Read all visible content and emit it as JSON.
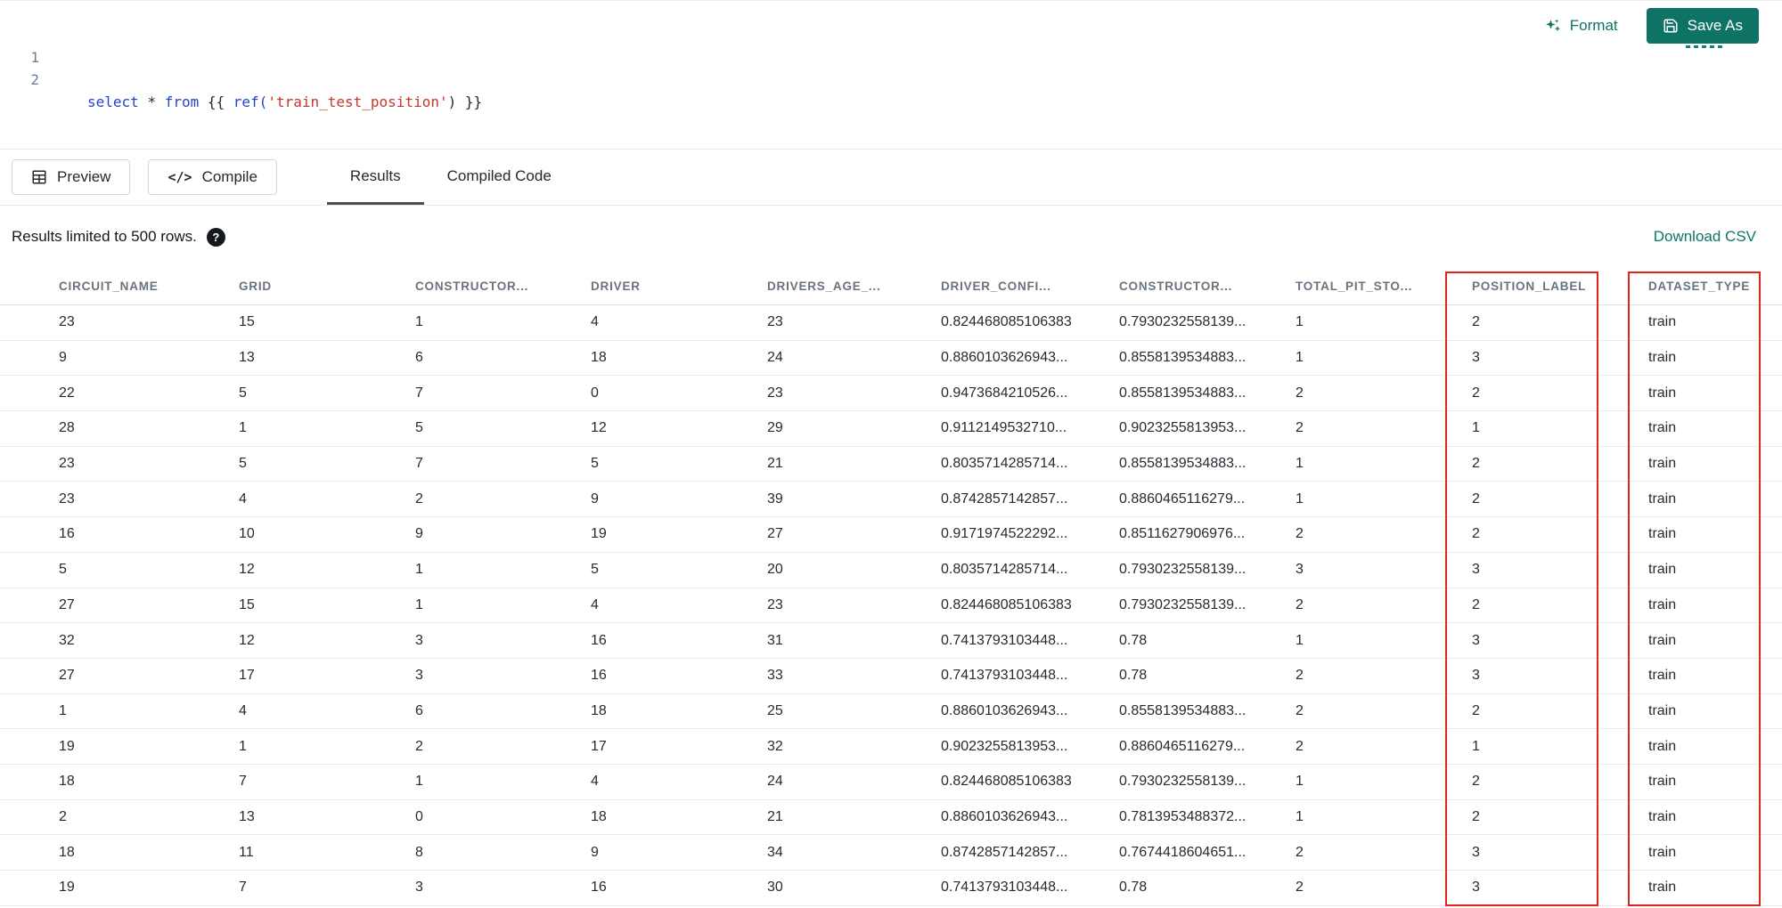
{
  "colors": {
    "accent_teal": "#0e7364",
    "highlight_red": "#e0241b"
  },
  "editor": {
    "line_numbers": [
      "1",
      "2"
    ],
    "code_tokens": [
      {
        "text": "select",
        "type": "keyword"
      },
      {
        "text": " ",
        "type": "plain"
      },
      {
        "text": "*",
        "type": "operator"
      },
      {
        "text": " ",
        "type": "plain"
      },
      {
        "text": "from",
        "type": "keyword"
      },
      {
        "text": " {{ ",
        "type": "plain"
      },
      {
        "text": "ref(",
        "type": "function"
      },
      {
        "text": "'train_test_position'",
        "type": "string"
      },
      {
        "text": ")",
        "type": "plain"
      },
      {
        "text": " }}",
        "type": "plain"
      }
    ],
    "actions": {
      "format": "Format",
      "save_as": "Save As"
    }
  },
  "toolbar": {
    "preview": "Preview",
    "compile": "Compile",
    "compile_glyph": "</>",
    "tabs": [
      {
        "label": "Results",
        "active": true
      },
      {
        "label": "Compiled Code",
        "active": false
      }
    ]
  },
  "results_bar": {
    "info": "Results limited to 500 rows.",
    "help_icon": "?",
    "download": "Download CSV"
  },
  "table": {
    "columns": [
      "CIRCUIT_NAME",
      "GRID",
      "CONSTRUCTOR...",
      "DRIVER",
      "DRIVERS_AGE_...",
      "DRIVER_CONFI...",
      "CONSTRUCTOR...",
      "TOTAL_PIT_STO...",
      "POSITION_LABEL",
      "DATASET_TYPE"
    ],
    "rows": [
      [
        "23",
        "15",
        "1",
        "4",
        "23",
        "0.824468085106383",
        "0.7930232558139...",
        "1",
        "2",
        "train"
      ],
      [
        "9",
        "13",
        "6",
        "18",
        "24",
        "0.8860103626943...",
        "0.8558139534883...",
        "1",
        "3",
        "train"
      ],
      [
        "22",
        "5",
        "7",
        "0",
        "23",
        "0.9473684210526...",
        "0.8558139534883...",
        "2",
        "2",
        "train"
      ],
      [
        "28",
        "1",
        "5",
        "12",
        "29",
        "0.9112149532710...",
        "0.9023255813953...",
        "2",
        "1",
        "train"
      ],
      [
        "23",
        "5",
        "7",
        "5",
        "21",
        "0.8035714285714...",
        "0.8558139534883...",
        "1",
        "2",
        "train"
      ],
      [
        "23",
        "4",
        "2",
        "9",
        "39",
        "0.8742857142857...",
        "0.8860465116279...",
        "1",
        "2",
        "train"
      ],
      [
        "16",
        "10",
        "9",
        "19",
        "27",
        "0.9171974522292...",
        "0.8511627906976...",
        "2",
        "2",
        "train"
      ],
      [
        "5",
        "12",
        "1",
        "5",
        "20",
        "0.8035714285714...",
        "0.7930232558139...",
        "3",
        "3",
        "train"
      ],
      [
        "27",
        "15",
        "1",
        "4",
        "23",
        "0.824468085106383",
        "0.7930232558139...",
        "2",
        "2",
        "train"
      ],
      [
        "32",
        "12",
        "3",
        "16",
        "31",
        "0.7413793103448...",
        "0.78",
        "1",
        "3",
        "train"
      ],
      [
        "27",
        "17",
        "3",
        "16",
        "33",
        "0.7413793103448...",
        "0.78",
        "2",
        "3",
        "train"
      ],
      [
        "1",
        "4",
        "6",
        "18",
        "25",
        "0.8860103626943...",
        "0.8558139534883...",
        "2",
        "2",
        "train"
      ],
      [
        "19",
        "1",
        "2",
        "17",
        "32",
        "0.9023255813953...",
        "0.8860465116279...",
        "2",
        "1",
        "train"
      ],
      [
        "18",
        "7",
        "1",
        "4",
        "24",
        "0.824468085106383",
        "0.7930232558139...",
        "1",
        "2",
        "train"
      ],
      [
        "2",
        "13",
        "0",
        "18",
        "21",
        "0.8860103626943...",
        "0.7813953488372...",
        "1",
        "2",
        "train"
      ],
      [
        "18",
        "11",
        "8",
        "9",
        "34",
        "0.8742857142857...",
        "0.7674418604651...",
        "2",
        "3",
        "train"
      ],
      [
        "19",
        "7",
        "3",
        "16",
        "30",
        "0.7413793103448...",
        "0.78",
        "2",
        "3",
        "train"
      ]
    ]
  }
}
